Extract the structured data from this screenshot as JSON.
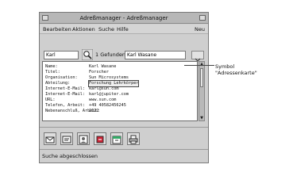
{
  "window": {
    "title": "Adreßmanager - Adreßmanager"
  },
  "menubar": {
    "items": [
      {
        "label": "Bearbeiten"
      },
      {
        "label": "Aktionen"
      },
      {
        "label": "Suche"
      },
      {
        "label": "Hilfe"
      },
      {
        "label": "Neu"
      }
    ]
  },
  "toolbar": {
    "search_value": "Karl",
    "found_label": "1 Gefunden",
    "result_value": "Karl Wasane"
  },
  "card": {
    "rows": [
      {
        "label": "Name:",
        "value": "Karl Wasane"
      },
      {
        "label": "Titel:",
        "value": "Forscher"
      },
      {
        "label": "Organisation:",
        "value": "Sun Microsystems"
      },
      {
        "label": "Abteilung:",
        "value": "Forschung Lehrkörper"
      },
      {
        "label": "Internet-E-Mail:",
        "value": "karl@sun.com"
      },
      {
        "label": "Internet-E-Mail:",
        "value": "karl@jupiter.com"
      },
      {
        "label": "URL:",
        "value": "www.sun.com"
      },
      {
        "label": "Telefon, Arbeit:",
        "value": "+49 40582456245"
      },
      {
        "label": "Nebenanschluß, Arbeit:",
        "value": "2122"
      }
    ]
  },
  "status": {
    "text": "Suche abgeschlossen"
  },
  "callout": {
    "line1": "Symbol",
    "line2": "\"Adressenkarte\""
  },
  "icons": [
    "mail-icon",
    "address-card-icon",
    "contacts-icon",
    "send-icon",
    "calendar-icon",
    "printer-icon"
  ]
}
